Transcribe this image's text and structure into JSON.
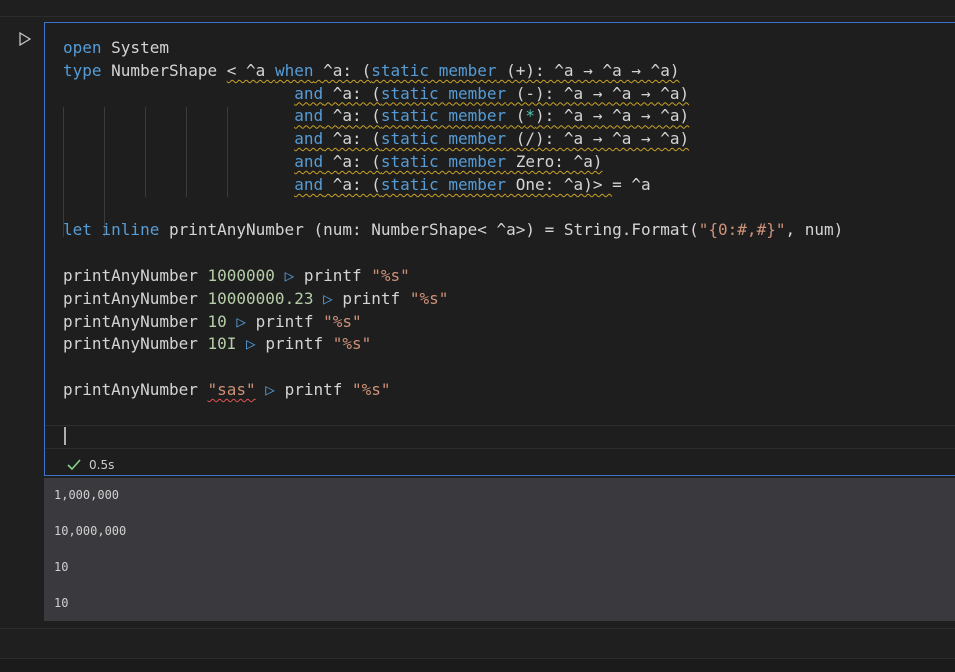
{
  "cell": {
    "code_lines": [
      {
        "segments": [
          [
            "kw",
            "open"
          ],
          [
            "ty",
            " System"
          ]
        ]
      },
      {
        "segments": [
          [
            "kw",
            "type"
          ],
          [
            "ty",
            " NumberShape "
          ],
          [
            "sq",
            "< ^a "
          ],
          [
            "sqk",
            "when"
          ],
          [
            "sq",
            " ^a: ("
          ],
          [
            "sqk",
            "static member"
          ],
          [
            "sq",
            " (+): ^a → ^a → ^a)"
          ]
        ]
      },
      {
        "segments": [
          [
            "sp",
            "                        "
          ],
          [
            "sqk",
            "and"
          ],
          [
            "sq",
            " ^a: ("
          ],
          [
            "sqk",
            "static member"
          ],
          [
            "sq",
            " (-): ^a → ^a → ^a)"
          ]
        ]
      },
      {
        "segments": [
          [
            "sp",
            "                        "
          ],
          [
            "sqk",
            "and"
          ],
          [
            "sq",
            " ^a: ("
          ],
          [
            "sqk",
            "static member"
          ],
          [
            "sq",
            " ("
          ],
          [
            "sqg",
            "*"
          ],
          [
            "sq",
            "): ^a → ^a → ^a)"
          ]
        ]
      },
      {
        "segments": [
          [
            "sp",
            "                        "
          ],
          [
            "sqk",
            "and"
          ],
          [
            "sq",
            " ^a: ("
          ],
          [
            "sqk",
            "static member"
          ],
          [
            "sq",
            " (/): ^a → ^a → ^a)"
          ]
        ]
      },
      {
        "segments": [
          [
            "sp",
            "                        "
          ],
          [
            "sqk",
            "and"
          ],
          [
            "sq",
            " ^a: ("
          ],
          [
            "sqk",
            "static member"
          ],
          [
            "sq",
            " Zero: ^a)"
          ]
        ]
      },
      {
        "segments": [
          [
            "sp",
            "                        "
          ],
          [
            "sqk",
            "and"
          ],
          [
            "sq",
            " ^a: ("
          ],
          [
            "sqk",
            "static member"
          ],
          [
            "sq",
            " One: ^a)> "
          ],
          [
            "ty",
            "= ^a"
          ]
        ]
      },
      {
        "segments": []
      },
      {
        "segments": [
          [
            "kw",
            "let inline"
          ],
          [
            "ty",
            " printAnyNumber "
          ],
          [
            "ty",
            "(num: NumberShape< ^a>) = String.Format("
          ],
          [
            "str",
            "\"{0:#,#}\""
          ],
          [
            "ty",
            ", num)"
          ]
        ]
      },
      {
        "segments": []
      },
      {
        "segments": [
          [
            "ty",
            "printAnyNumber "
          ],
          [
            "num",
            "1000000"
          ],
          [
            "kw",
            " ▷ "
          ],
          [
            "ty",
            "printf "
          ],
          [
            "str",
            "\"%s\""
          ]
        ]
      },
      {
        "segments": [
          [
            "ty",
            "printAnyNumber "
          ],
          [
            "num",
            "10000000.23"
          ],
          [
            "kw",
            " ▷ "
          ],
          [
            "ty",
            "printf "
          ],
          [
            "str",
            "\"%s\""
          ]
        ]
      },
      {
        "segments": [
          [
            "ty",
            "printAnyNumber "
          ],
          [
            "num",
            "10"
          ],
          [
            "kw",
            " ▷ "
          ],
          [
            "ty",
            "printf "
          ],
          [
            "str",
            "\"%s\""
          ]
        ]
      },
      {
        "segments": [
          [
            "ty",
            "printAnyNumber "
          ],
          [
            "num",
            "10I"
          ],
          [
            "kw",
            " ▷ "
          ],
          [
            "ty",
            "printf "
          ],
          [
            "str",
            "\"%s\""
          ]
        ]
      },
      {
        "segments": []
      },
      {
        "segments": [
          [
            "ty",
            "printAnyNumber "
          ],
          [
            "strr",
            "\"sas\""
          ],
          [
            "kw",
            " ▷ "
          ],
          [
            "ty",
            "printf "
          ],
          [
            "str",
            "\"%s\""
          ]
        ]
      }
    ],
    "execution_time": "0.5s"
  },
  "output": {
    "lines": [
      "1,000,000",
      "10,000,000",
      "10",
      "10"
    ]
  },
  "icons": {
    "run": "run-triangle-icon",
    "success": "checkmark-icon"
  },
  "colors": {
    "focus_border": "#3b74c9",
    "keyword": "#569cd6",
    "number": "#b5cea8",
    "string": "#ce9178",
    "warning_squiggle": "#c9a227",
    "error_squiggle": "#e05252",
    "success": "#89d185"
  }
}
